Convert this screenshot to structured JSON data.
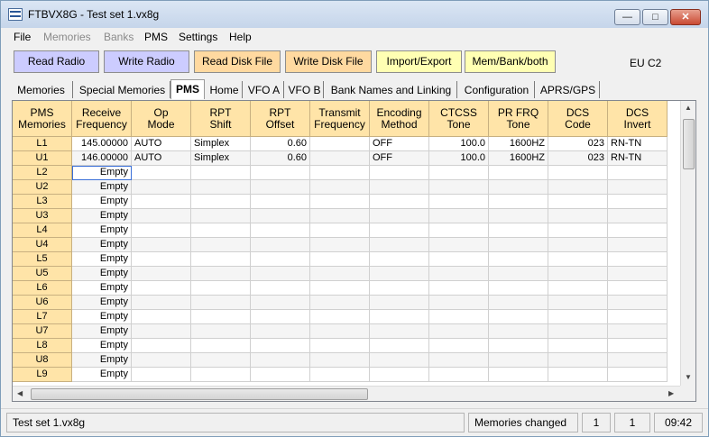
{
  "window": {
    "title": "FTBVX8G - Test set 1.vx8g"
  },
  "menu": [
    "File",
    "Memories",
    "Banks",
    "PMS",
    "Settings",
    "Help"
  ],
  "toolbar": {
    "read_radio": "Read Radio",
    "write_radio": "Write Radio",
    "read_disk": "Read Disk File",
    "write_disk": "Write Disk File",
    "import_export": "Import/Export",
    "mem_bank": "Mem/Bank/both",
    "region": "EU C2"
  },
  "tabs": [
    "Memories",
    "Special Memories",
    "PMS",
    "Home",
    "VFO A",
    "VFO B",
    "Bank Names and Linking",
    "Configuration",
    "APRS/GPS"
  ],
  "grid": {
    "headers": [
      [
        "PMS",
        "Memories"
      ],
      [
        "Receive",
        "Frequency"
      ],
      [
        "Op",
        "Mode"
      ],
      [
        "RPT",
        "Shift"
      ],
      [
        "RPT",
        "Offset"
      ],
      [
        "Transmit",
        "Frequency"
      ],
      [
        "Encoding",
        "Method"
      ],
      [
        "CTCSS",
        "Tone"
      ],
      [
        "PR FRQ",
        "Tone"
      ],
      [
        "DCS",
        "Code"
      ],
      [
        "DCS",
        "Invert"
      ]
    ],
    "rows": [
      [
        "L1",
        "145.00000",
        "AUTO",
        "Simplex",
        "0.60",
        "",
        "OFF",
        "100.0",
        "1600HZ",
        "023",
        "RN-TN"
      ],
      [
        "U1",
        "146.00000",
        "AUTO",
        "Simplex",
        "0.60",
        "",
        "OFF",
        "100.0",
        "1600HZ",
        "023",
        "RN-TN"
      ],
      [
        "L2",
        "Empty",
        "",
        "",
        "",
        "",
        "",
        "",
        "",
        "",
        ""
      ],
      [
        "U2",
        "Empty",
        "",
        "",
        "",
        "",
        "",
        "",
        "",
        "",
        ""
      ],
      [
        "L3",
        "Empty",
        "",
        "",
        "",
        "",
        "",
        "",
        "",
        "",
        ""
      ],
      [
        "U3",
        "Empty",
        "",
        "",
        "",
        "",
        "",
        "",
        "",
        "",
        ""
      ],
      [
        "L4",
        "Empty",
        "",
        "",
        "",
        "",
        "",
        "",
        "",
        "",
        ""
      ],
      [
        "U4",
        "Empty",
        "",
        "",
        "",
        "",
        "",
        "",
        "",
        "",
        ""
      ],
      [
        "L5",
        "Empty",
        "",
        "",
        "",
        "",
        "",
        "",
        "",
        "",
        ""
      ],
      [
        "U5",
        "Empty",
        "",
        "",
        "",
        "",
        "",
        "",
        "",
        "",
        ""
      ],
      [
        "L6",
        "Empty",
        "",
        "",
        "",
        "",
        "",
        "",
        "",
        "",
        ""
      ],
      [
        "U6",
        "Empty",
        "",
        "",
        "",
        "",
        "",
        "",
        "",
        "",
        ""
      ],
      [
        "L7",
        "Empty",
        "",
        "",
        "",
        "",
        "",
        "",
        "",
        "",
        ""
      ],
      [
        "U7",
        "Empty",
        "",
        "",
        "",
        "",
        "",
        "",
        "",
        "",
        ""
      ],
      [
        "L8",
        "Empty",
        "",
        "",
        "",
        "",
        "",
        "",
        "",
        "",
        ""
      ],
      [
        "U8",
        "Empty",
        "",
        "",
        "",
        "",
        "",
        "",
        "",
        "",
        ""
      ],
      [
        "L9",
        "Empty",
        "",
        "",
        "",
        "",
        "",
        "",
        "",
        "",
        ""
      ]
    ]
  },
  "status": {
    "file": "Test set 1.vx8g",
    "message": "Memories changed",
    "col": "1",
    "row": "1",
    "time": "09:42"
  },
  "icons": {
    "app": "radio-app-icon",
    "minimize": "minimize-icon",
    "maximize": "maximize-icon",
    "close": "close-icon"
  }
}
